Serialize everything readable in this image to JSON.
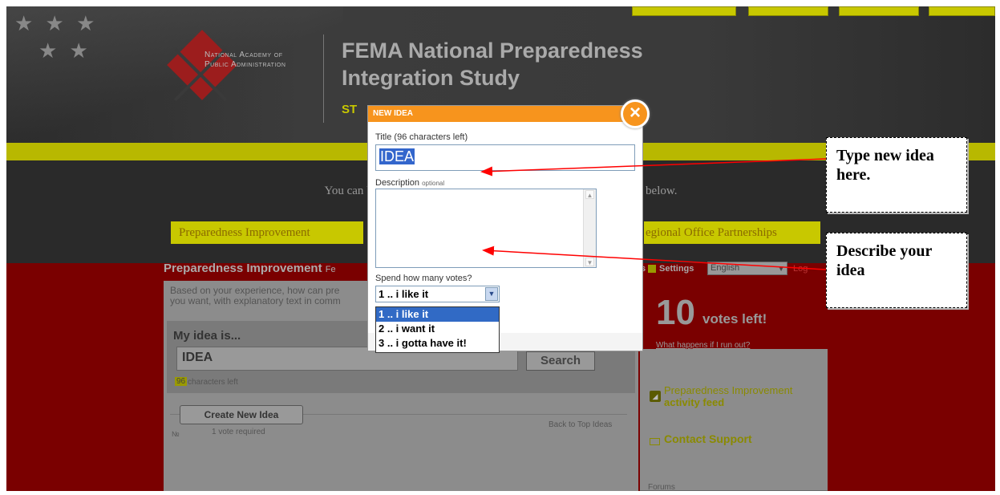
{
  "header": {
    "org_name_line1": "National Academy of",
    "org_name_line2": "Public Administration",
    "site_title": "FEMA National Preparedness Integration Study",
    "tagline": "ST"
  },
  "intro": {
    "text": "You can begin s                                                                    e topics below.",
    "topics": [
      "Preparedness Improvement",
      "egional Office Partnerships"
    ]
  },
  "section": {
    "title": "Preparedness Improvement",
    "title_suffix": "Fe",
    "feeds_prefix": "s",
    "settings": "Settings",
    "language": "English",
    "login": "Log"
  },
  "main": {
    "prompt": "Based on your experience, how can pre\nyou want, with explanatory text in comm",
    "idea_label": "My idea is...",
    "idea_value": "IDEA",
    "search": "Search",
    "chars_count": "96",
    "chars_label": "characters left",
    "create_button": "Create New Idea",
    "vote_required": "1 vote required",
    "num_sign": "№",
    "back_to_top": "Back to Top Ideas"
  },
  "sidebar": {
    "votes_count": "10",
    "votes_left": "votes left!",
    "what_happens": "What happens if I run out?",
    "feed_prefix": "Preparedness Improvement",
    "feed_bold": "activity feed",
    "contact": "Contact Support",
    "forums": "Forums"
  },
  "modal": {
    "title": "NEW IDEA",
    "close_glyph": "×",
    "title_label": "Title (96 characters left)",
    "title_value": "IDEA",
    "desc_label": "Description",
    "desc_optional": "optional",
    "votes_label": "Spend how many votes?",
    "votes_selected": "1 .. i like it",
    "votes_options": [
      "1 .. i like it",
      "2 .. i want it",
      "3 .. i gotta have it!"
    ]
  },
  "annotations": {
    "callout_1": "Type new idea here.",
    "callout_2": "Describe your idea"
  },
  "colors": {
    "modal_header": "#f7941d",
    "arrow": "#ff0000",
    "selection": "#316ac5"
  }
}
